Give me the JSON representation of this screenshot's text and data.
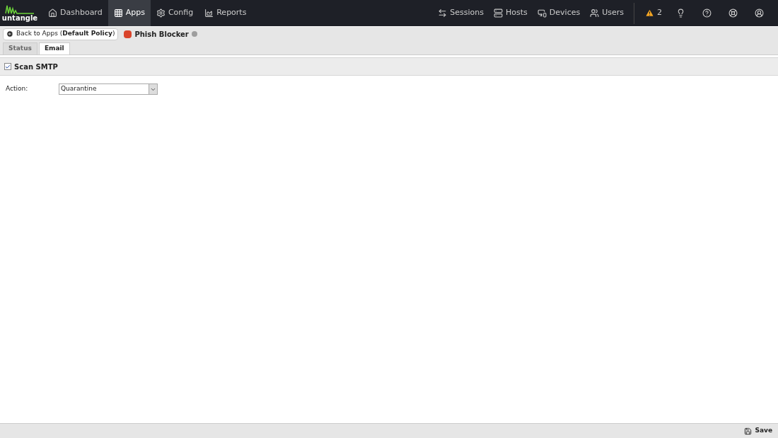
{
  "logo": "untangle",
  "nav": {
    "items": [
      {
        "label": "Dashboard",
        "selected": false
      },
      {
        "label": "Apps",
        "selected": true
      },
      {
        "label": "Config",
        "selected": false
      },
      {
        "label": "Reports",
        "selected": false
      }
    ],
    "right_items": [
      {
        "label": "Sessions"
      },
      {
        "label": "Hosts"
      },
      {
        "label": "Devices"
      },
      {
        "label": "Users"
      }
    ],
    "alerts": "2"
  },
  "app_bar": {
    "back_button": {
      "label": "Back to Apps (**Default Policy**)"
    },
    "app_name": "Phish Blocker",
    "status": {
      "color": "#9e9e9e"
    }
  },
  "tabs": [
    {
      "label": "Status",
      "selected": false
    },
    {
      "label": "Email",
      "selected": true
    }
  ],
  "section": {
    "label": "Scan SMTP",
    "checked": true
  },
  "fields": [
    {
      "label": "Action:",
      "value": "Quarantine"
    }
  ],
  "footer": {
    "save": "Save"
  }
}
